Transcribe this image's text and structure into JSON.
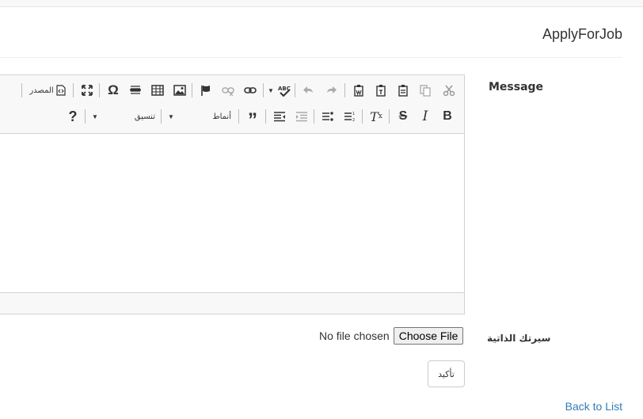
{
  "header": {
    "title": "ApplyForJob"
  },
  "form": {
    "message_label": "Message",
    "cv_label": "سيرتك الذاتية",
    "file": {
      "status_text": "No file chosen",
      "button_label": "Choose File"
    },
    "submit_label": "تأكيد"
  },
  "editor": {
    "toolbar": {
      "source_label": "المصدر",
      "styles_label": "أنماط",
      "format_label": "تنسيق"
    }
  },
  "footer": {
    "back_link": "Back to List"
  }
}
